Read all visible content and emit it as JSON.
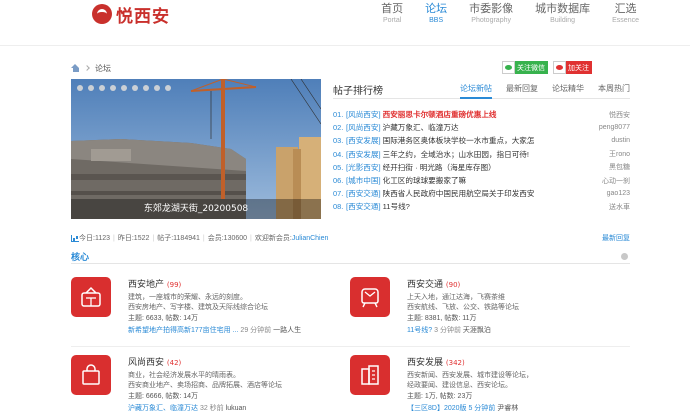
{
  "site": {
    "logo_text": "悦西安"
  },
  "nav": [
    {
      "zh": "首页",
      "en": "Portal",
      "active": false
    },
    {
      "zh": "论坛",
      "en": "BBS",
      "active": true
    },
    {
      "zh": "市委影像",
      "en": "Photography",
      "active": false
    },
    {
      "zh": "城市数据库",
      "en": "Building",
      "active": false
    },
    {
      "zh": "汇选",
      "en": "Essence",
      "active": false
    }
  ],
  "breadcrumb": {
    "current": "论坛"
  },
  "follow": {
    "wechat": "关注微信",
    "weibo": "加关注"
  },
  "slideshow": {
    "caption": "东郊龙湖天街_20200508",
    "dot_count": 9
  },
  "ranking": {
    "title": "帖子排行榜",
    "tabs": [
      {
        "label": "论坛新帖",
        "active": true
      },
      {
        "label": "最新回复",
        "active": false
      },
      {
        "label": "论坛精华",
        "active": false
      },
      {
        "label": "本周热门",
        "active": false
      }
    ],
    "items": [
      {
        "num": "01.",
        "cat": "[风尚西安]",
        "title": "西安丽思卡尔顿酒店重磅优惠上线",
        "user": "悦西安",
        "hot": true
      },
      {
        "num": "02.",
        "cat": "[风尚西安]",
        "title": "沪藏万象汇、临潼万达",
        "user": "peng8077",
        "hot": false
      },
      {
        "num": "03.",
        "cat": "[西安发展]",
        "title": "国际港务区奥体板块学校一水市重点，大家怎",
        "user": "dustin",
        "hot": false
      },
      {
        "num": "04.",
        "cat": "[西安发展]",
        "title": "三年之约，全域治水；山水田园，指日可待!",
        "user": "王rono",
        "hot": false
      },
      {
        "num": "05.",
        "cat": "[光影西安]",
        "title": "经开扫街 · 明光路（海星库存图）",
        "user": "黑包糖",
        "hot": false
      },
      {
        "num": "06.",
        "cat": "[城市中国]",
        "title": "化工区的球球要搬家了嘛",
        "user": "心动一刹",
        "hot": false
      },
      {
        "num": "07.",
        "cat": "[西安交通]",
        "title": "陕西省人民政府中国民用航空局关于印发西安",
        "user": "gao123",
        "hot": false
      },
      {
        "num": "08.",
        "cat": "[西安交通]",
        "title": "11号线?",
        "user": "送水車",
        "hot": false
      }
    ]
  },
  "stats": {
    "today_label": "今日:",
    "today": "1123",
    "yesterday_label": "昨日:",
    "yesterday": "1522",
    "posts_label": "帖子:",
    "posts": "1184941",
    "members_label": "会员:",
    "members": "130600",
    "newest_label": "欢迎新会员:",
    "newest": "JulianChien",
    "latest_reply": "最新回复"
  },
  "section": {
    "title": "核心"
  },
  "forums": [
    {
      "name": "西安地产",
      "count": "(99)",
      "desc1": "建筑，一座城市的荣耀、永远的刻度。",
      "desc2": "西安房地产、写字楼、建筑及天际线综合论坛",
      "stat": "主题: 6633, 帖数: 14万",
      "last_link": "新希望地产拍得高新177亩住宅用 ...",
      "last_time": "29 分钟前",
      "last_user": "一路人生",
      "icon": "building-icon"
    },
    {
      "name": "西安交通",
      "count": "(90)",
      "desc1": "上天入地，通江达海，飞赛茶维",
      "desc2": "西安航线、飞放、公交、铁路等论坛",
      "stat": "主题: 8381, 帖数: 11万",
      "last_link": "11号线?",
      "last_time": "3 分钟前",
      "last_user": "天涯飘泊",
      "icon": "train-icon"
    },
    {
      "name": "风尚西安",
      "count": "(42)",
      "desc1": "商业，社会经济发展水平的晴雨表。",
      "desc2": "西安商业地产、卖场招商、品牌拓展、酒店等论坛",
      "stat": "主题: 6666, 帖数: 14万",
      "last_link": "沪藏万象汇、临潼万达",
      "last_time": "32 秒前",
      "last_user": "lukuan",
      "icon": "shopping-bag-icon"
    },
    {
      "name": "西安发展",
      "count": "(342)",
      "desc1": "西安新闻、西安发展、城市建设等论坛，",
      "desc2": "经政要闻、建设信息、西安论坛。",
      "stat": "主题: 1万, 帖数: 23万",
      "last_link": "【三区8D】2020版 5 分钟前",
      "last_time": "",
      "last_user": "尹睿林",
      "icon": "city-icon"
    }
  ],
  "colors": {
    "accent": "#2a8ad6",
    "red": "#d92f2f",
    "hot": "#e03131"
  }
}
